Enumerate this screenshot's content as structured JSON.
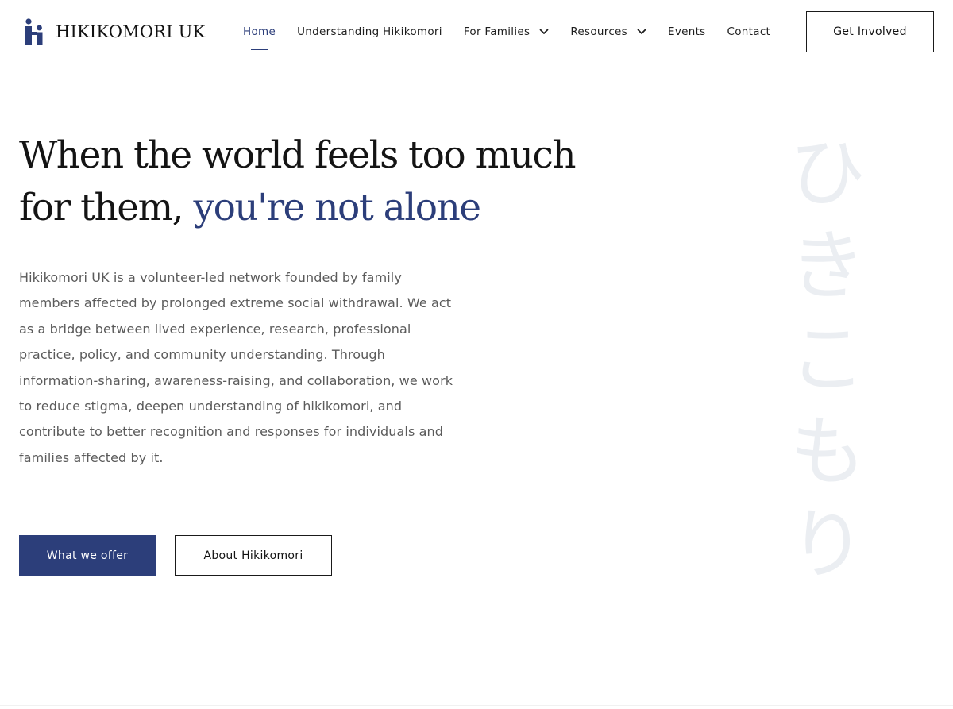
{
  "brand": {
    "name": "HIKIKOMORI UK",
    "logo_icon": "two-people-icon",
    "accent_color": "#2c3e7a"
  },
  "nav": {
    "items": [
      {
        "label": "Home",
        "active": true,
        "dropdown": false
      },
      {
        "label": "Understanding Hikikomori",
        "active": false,
        "dropdown": false
      },
      {
        "label": "For Families",
        "active": false,
        "dropdown": true
      },
      {
        "label": "Resources",
        "active": false,
        "dropdown": true
      },
      {
        "label": "Events",
        "active": false,
        "dropdown": false
      },
      {
        "label": "Contact",
        "active": false,
        "dropdown": false
      }
    ],
    "cta_label": "Get Involved"
  },
  "hero": {
    "title_line1": "When the world feels too much",
    "title_line2_plain": "for them, ",
    "title_line2_accent": "you're not alone",
    "body": "Hikikomori UK is a volunteer-led network founded by family members affected by prolonged extreme social withdrawal. We act as a bridge between lived experience, research, professional practice, policy, and community understanding. Through information-sharing, awareness-raising, and collaboration, we work to reduce stigma, deepen understanding of hikikomori, and contribute to better recognition and responses for individuals and families affected by it.",
    "primary_button": "What we offer",
    "secondary_button": "About Hikikomori"
  },
  "decor": {
    "kana": [
      "ひ",
      "き",
      "こ",
      "も",
      "り"
    ],
    "kana_color": "#ebeef2"
  }
}
